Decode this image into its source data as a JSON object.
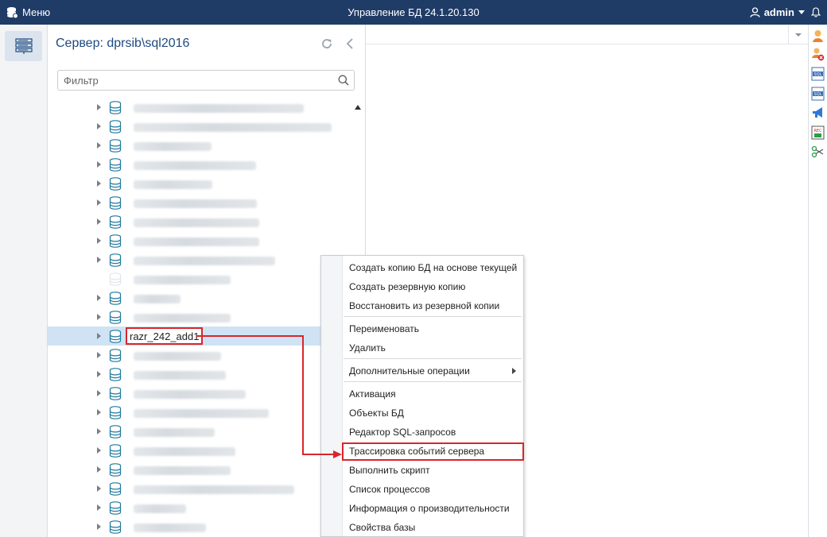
{
  "topbar": {
    "menu_label": "Меню",
    "title": "Управление БД 24.1.20.130",
    "user": "admin",
    "bg_color": "#1f3c67"
  },
  "server_panel": {
    "title": "Сервер: dprsib\\sql2016",
    "filter_placeholder": "Фильтр",
    "selected_db_name": "razr_242_add1"
  },
  "context_menu": {
    "items": [
      "Создать копию БД на основе текущей",
      "Создать резервную копию",
      "Восстановить из резервной копии",
      "Переименовать",
      "Удалить",
      "Дополнительные операции",
      "Активация",
      "Объекты БД",
      "Редактор SQL-запросов",
      "Трассировка событий сервера",
      "Выполнить скрипт",
      "Список процессов",
      "Информация о производительности",
      "Свойства базы"
    ],
    "highlighted_item": "Трассировка событий сервера"
  },
  "right_toolbar": {
    "icons": [
      "user-icon",
      "alert-user-icon",
      "sql-icon",
      "sql-icon-2",
      "megaphone-icon",
      "rec-icon",
      "scissors-icon"
    ]
  },
  "colors": {
    "accent": "#1f4a80",
    "highlight_red": "#d9262b",
    "selection": "#cfe3f5"
  }
}
